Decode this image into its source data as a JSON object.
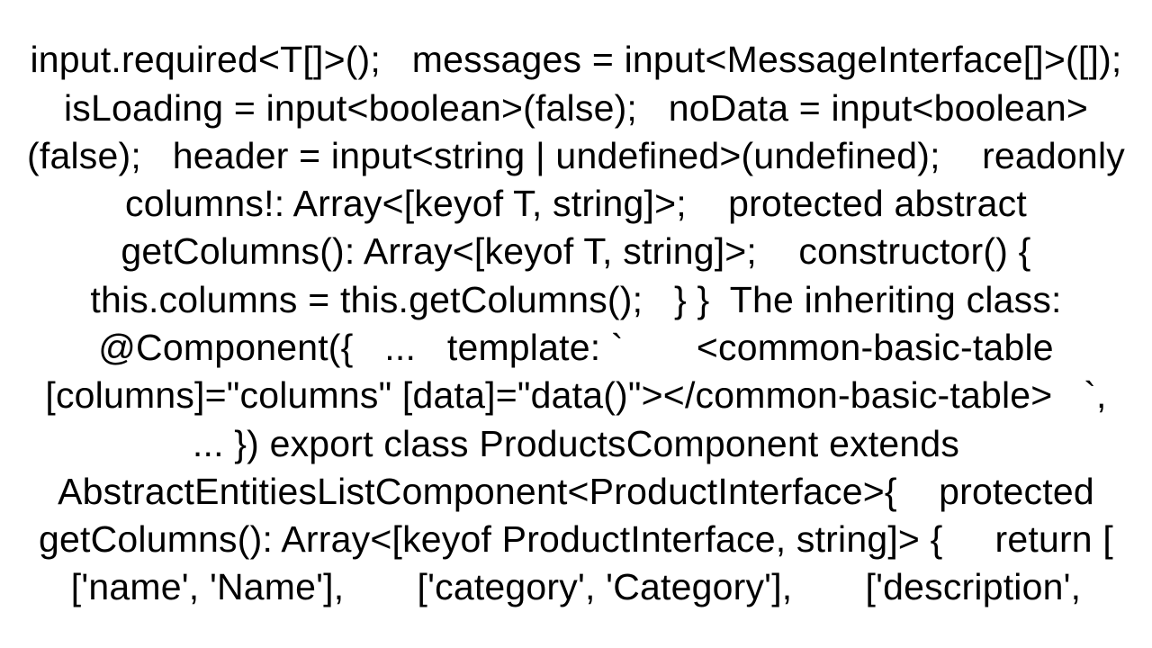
{
  "code_text": "input.required<T[]>();   messages = input<MessageInterface[]>([]);   isLoading = input<boolean>(false);   noData = input<boolean>(false);   header = input<string | undefined>(undefined);    readonly columns!: Array<[keyof T, string]>;    protected abstract getColumns(): Array<[keyof T, string]>;    constructor() {     this.columns = this.getColumns();   } }  The inheriting class: @Component({   ...   template: `       <common-basic-table [columns]=\"columns\" [data]=\"data()\"></common-basic-table>   `,     ... }) export class ProductsComponent extends AbstractEntitiesListComponent<ProductInterface>{    protected getColumns(): Array<[keyof ProductInterface, string]> {     return [       ['name', 'Name'],       ['category', 'Category'],       ['description',"
}
